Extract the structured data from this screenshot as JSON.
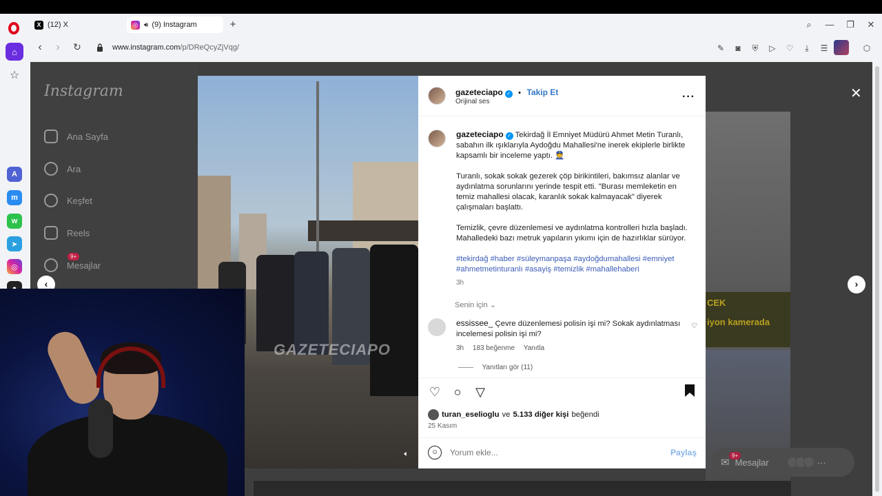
{
  "browser": {
    "tabs": [
      {
        "label": "(12) X",
        "icon": "x-logo-icon"
      },
      {
        "label": "(9) Instagram",
        "icon": "instagram-icon",
        "active": true
      }
    ],
    "url_host": "www.instagram.com",
    "url_path": "/p/DReQcyZjVqg/"
  },
  "instagram": {
    "logo": "Instagram",
    "nav": [
      {
        "label": "Ana Sayfa",
        "icon": "home-icon"
      },
      {
        "label": "Ara",
        "icon": "search-icon"
      },
      {
        "label": "Keşfet",
        "icon": "compass-icon"
      },
      {
        "label": "Reels",
        "icon": "reels-icon"
      },
      {
        "label": "Mesajlar",
        "icon": "messenger-icon",
        "badge": "9+"
      }
    ],
    "right_preview": {
      "text1": "CEK",
      "text2": "iyon kamerada"
    },
    "messages_pill": {
      "label": "Mesajlar",
      "badge": "9+"
    }
  },
  "post": {
    "username": "gazeteciapo",
    "follow_label": "Takip Et",
    "audio": "Orijinal ses",
    "watermark": "GAZETECIAPO",
    "caption_p1": "Tekirdağ İl Emniyet Müdürü Ahmet Metin Turanlı, sabahın ilk ışıklarıyla Aydoğdu Mahallesi'ne inerek ekiplerle birlikte kapsamlı bir inceleme yaptı. 👮",
    "caption_p2": "Turanlı, sokak sokak gezerek çöp birikintileri, bakımsız alanlar ve aydınlatma sorunlarını yerinde tespit etti. \"Burası memleketin en temiz mahallesi olacak, karanlık sokak kalmayacak\" diyerek çalışmaları başlattı.",
    "caption_p3": "Temizlik, çevre düzenlemesi ve aydınlatma kontrolleri hızla başladı. Mahalledeki bazı metruk yapıların yıkımı için de hazırlıklar sürüyor.",
    "hashtags": "#tekirdağ #haber #süleymanpaşa #aydoğdumahallesi #emniyet #ahmetmetinturanlı #asayiş #temizlik #mahallehaberi",
    "caption_time": "3h",
    "for_you": "Senin için",
    "comment": {
      "user": "essissee_",
      "text": "Çevre düzenlemesi polisin işi mi? Sokak aydınlatması incelemesi polisin işi mi?",
      "time": "3h",
      "likes": "183 beğenme",
      "reply": "Yanıtla",
      "view_replies": "Yanıtları gör (11)"
    },
    "likes_user": "turan_eselioglu",
    "likes_middle": "ve",
    "likes_count": "5.133 diğer kişi",
    "likes_suffix": "beğendi",
    "date": "25 Kasım",
    "comment_placeholder": "Yorum ekle...",
    "share_label": "Paylaş"
  },
  "colors": {
    "accent": "#3478c8",
    "opera_red": "#e0001b",
    "opera_purple": "#6b2de0",
    "verified": "#0095f6"
  }
}
